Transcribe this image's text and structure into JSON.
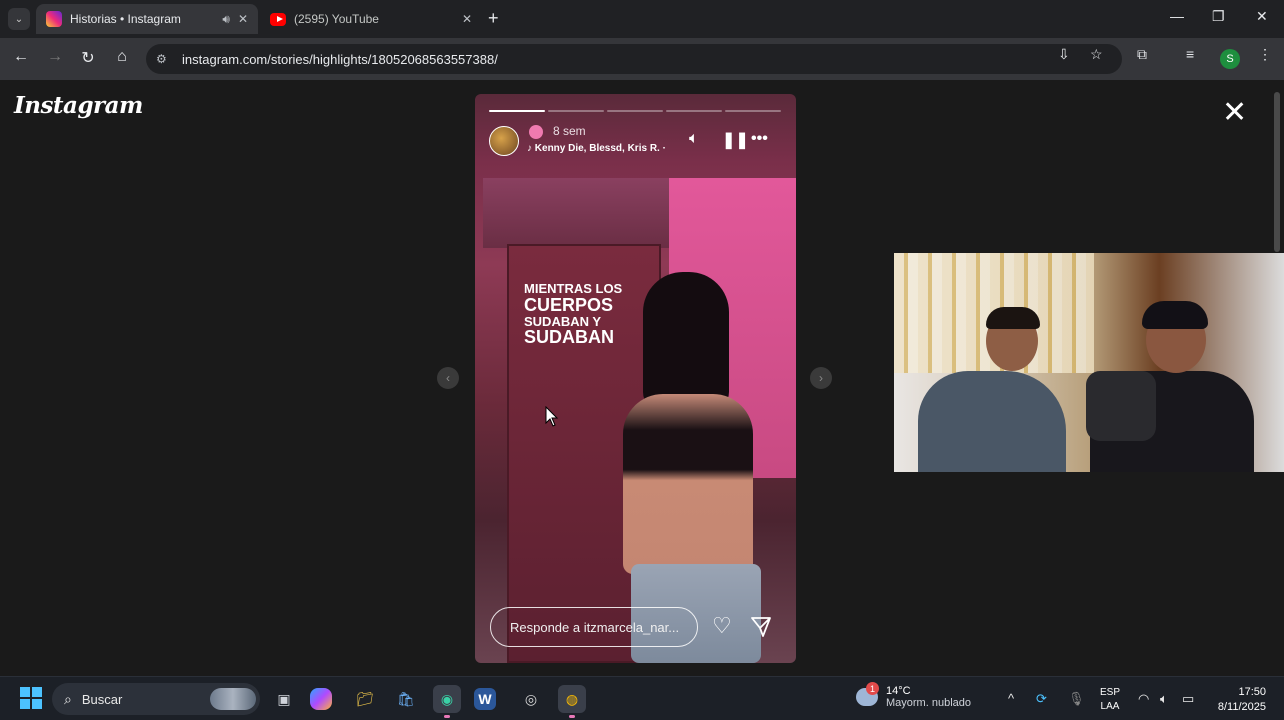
{
  "browser": {
    "tabs": [
      {
        "title": "Historias • Instagram",
        "audio_icon": "speaker-icon",
        "close": "✕",
        "active": true
      },
      {
        "title": "(2595) YouTube",
        "close": "✕",
        "active": false
      }
    ],
    "new_tab": "+",
    "window_controls": {
      "minimize": "—",
      "restore": "❐",
      "close": "✕"
    },
    "nav": {
      "back": "←",
      "forward": "→",
      "reload": "↻",
      "home": "⌂"
    },
    "url": "instagram.com/stories/highlights/18052068563557388/",
    "profile_initial": "S"
  },
  "instagram": {
    "logo": "Instagram",
    "close": "✕",
    "story": {
      "progress_segments": 5,
      "progress_filled_segments": 1,
      "time": "8 sem",
      "music": "Kenny Die, Blessd, Kris R. ·",
      "overlay_lines": [
        "MIENTRAS LOS",
        "CUERPOS",
        "SUDABAN Y",
        "SUDABAN"
      ],
      "reply_placeholder": "Responde a itzmarcela_nar...",
      "prev": "‹",
      "next": "›"
    }
  },
  "taskbar": {
    "search_label": "Buscar",
    "weather": {
      "temp": "14°C",
      "desc": "Mayorm. nublado",
      "badge": "1"
    },
    "lang": {
      "line1": "ESP",
      "line2": "LAA"
    },
    "clock": {
      "time": "17:50",
      "date": "8/11/2025"
    },
    "tray_up": "^"
  },
  "colors": {
    "accent": "#4cc2ff",
    "ig_pink": "#e2589a",
    "tab_bg": "#35363a",
    "page_bg": "#1a1a1a"
  }
}
